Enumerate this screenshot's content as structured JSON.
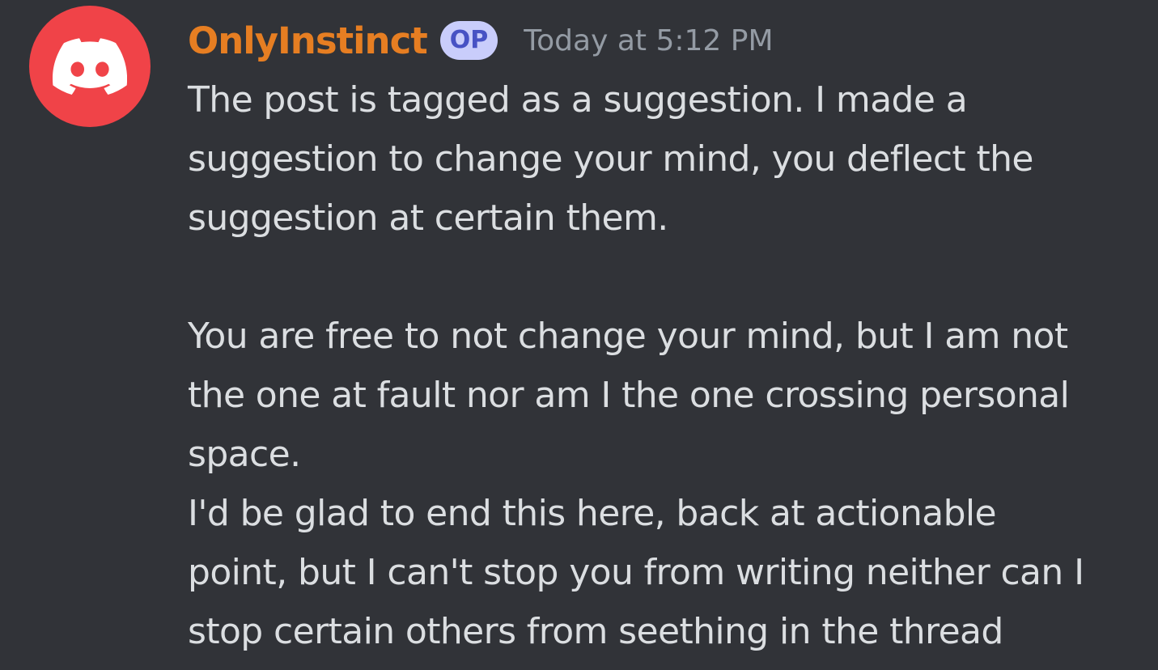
{
  "message": {
    "author": "OnlyInstinct",
    "badge": "OP",
    "timestamp": "Today at 5:12 PM",
    "avatar_icon": "discord-logo-icon",
    "colors": {
      "background": "#313338",
      "avatar": "#f04348",
      "author": "#e67e22",
      "badge_bg": "#c9cdfb",
      "badge_text": "#4752c4",
      "timestamp": "#949ba4",
      "text": "#dbdee1"
    },
    "lines": [
      "The post is tagged as a suggestion. I made a",
      "suggestion to change your mind, you deflect the",
      "suggestion at certain them.",
      "",
      "You are free to not change your mind, but I am not",
      "the one at fault nor am I the one crossing personal",
      "space.",
      "I'd be glad to end this here, back at actionable",
      "point, but I can't stop you from writing neither can I",
      "stop certain others from seething in the thread"
    ]
  }
}
